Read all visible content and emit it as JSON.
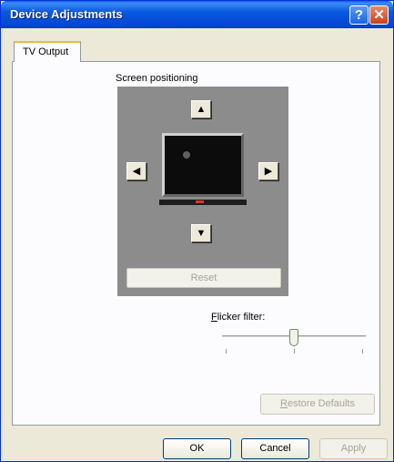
{
  "window": {
    "title": "Device Adjustments",
    "help_label": "?",
    "close_label": "✕"
  },
  "tabs": [
    {
      "label": "TV Output",
      "selected": true
    }
  ],
  "screen_positioning": {
    "label": "Screen positioning",
    "up_glyph": "▲",
    "down_glyph": "▼",
    "left_glyph": "◀",
    "right_glyph": "▶",
    "reset_label": "Reset",
    "reset_enabled": false
  },
  "flicker": {
    "label_first": "F",
    "label_rest": "licker filter:",
    "value_fraction": 0.5,
    "tick_count": 3
  },
  "restore_defaults": {
    "label_first": "R",
    "label_rest": "estore Defaults",
    "enabled": false
  },
  "footer": {
    "ok_label": "OK",
    "cancel_label": "Cancel",
    "apply_label": "Apply",
    "apply_enabled": false
  },
  "colors": {
    "titlebar": "#0a58e0",
    "dialog_bg": "#ece9d8",
    "panel_bg": "#fcfcfe",
    "positioning_bg": "#8c8c8c",
    "tab_highlight": "#f8b43a"
  }
}
